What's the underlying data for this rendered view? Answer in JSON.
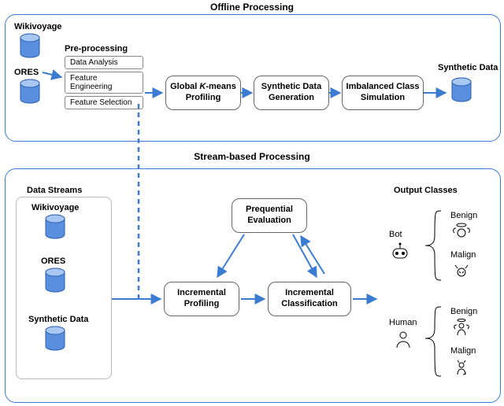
{
  "titles": {
    "offline": "Offline Processing",
    "stream": "Stream-based Processing"
  },
  "sources": {
    "wikivoyage": "Wikivoyage",
    "ores": "ORES",
    "synthetic": "Synthetic Data"
  },
  "preproc": {
    "header": "Pre-processing",
    "rows": {
      "da": "Data Analysis",
      "fe": "Feature Engineering",
      "fs": "Feature Selection"
    }
  },
  "steps": {
    "kmeans": "Global K-means Profiling",
    "synthgen": "Synthetic Data Generation",
    "imbal": "Imbalanced Class Simulation",
    "synthout": "Synthetic Data",
    "prequential": "Prequential Evaluation",
    "incprof": "Incremental Profiling",
    "incclass": "Incremental Classification"
  },
  "streams": {
    "header": "Data Streams"
  },
  "output": {
    "header": "Output Classes",
    "bot": "Bot",
    "human": "Human",
    "benign": "Benign",
    "malign": "Malign"
  }
}
